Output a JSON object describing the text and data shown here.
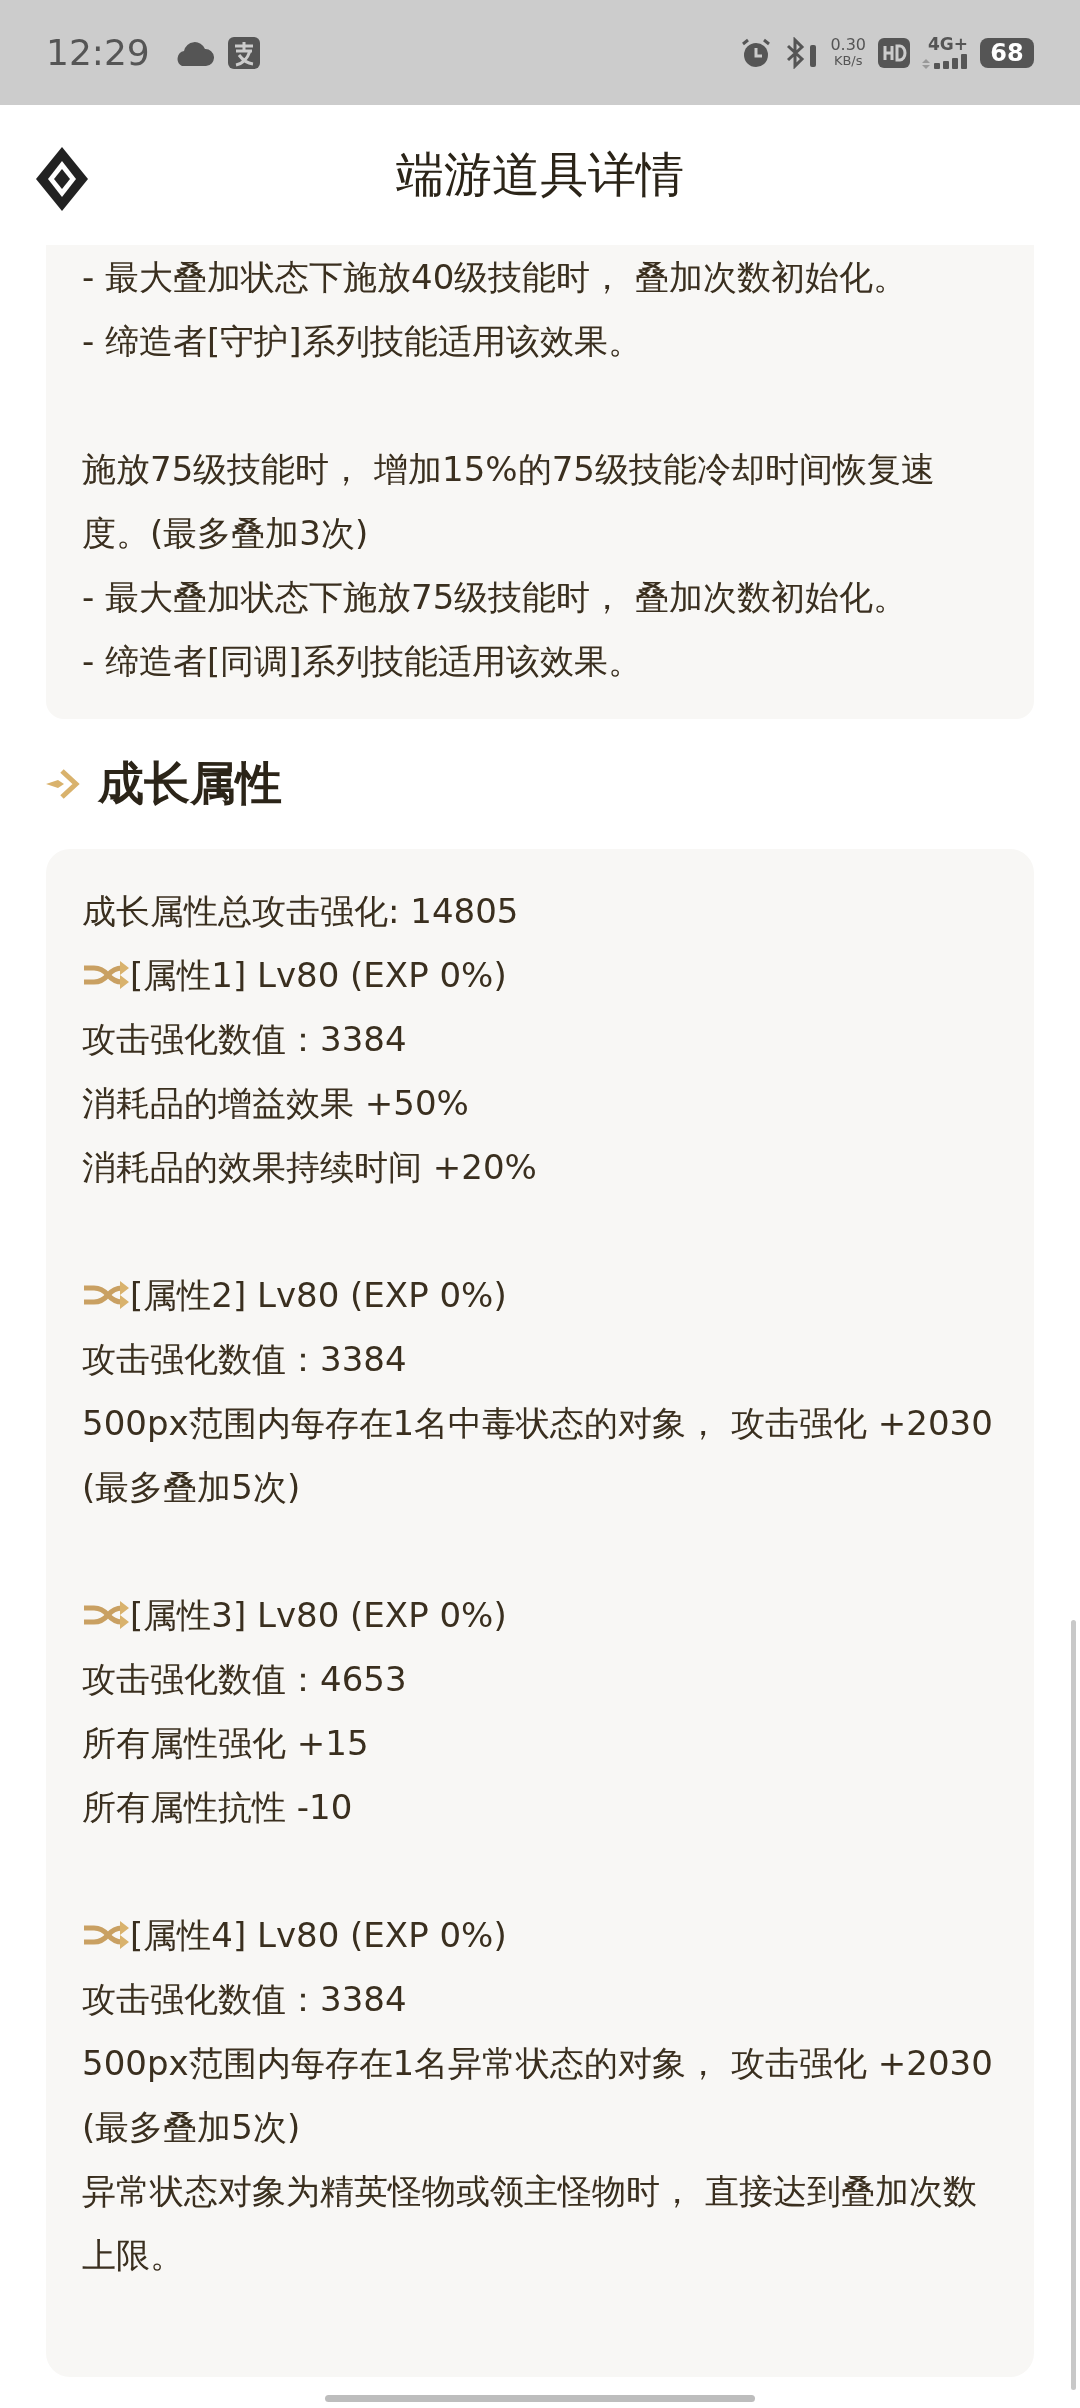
{
  "status_bar": {
    "time": "12:29",
    "net_speed": "0.30",
    "net_unit": "KB/s",
    "network": "4G+",
    "battery": "68"
  },
  "header": {
    "title": "端游道具详情"
  },
  "effect_card": {
    "paragraphs": [
      {
        "lines": [
          "- 最大叠加状态下施放40级技能时， 叠加次数初始化。",
          "- 缔造者[守护]系列技能适用该效果。"
        ]
      },
      {
        "lines": [
          "施放75级技能时， 增加15%的75级技能冷却时间恢复速度。(最多叠加3次)",
          "- 最大叠加状态下施放75级技能时， 叠加次数初始化。",
          "- 缔造者[同调]系列技能适用该效果。"
        ]
      }
    ]
  },
  "growth_section": {
    "title": "成长属性",
    "total": "成长属性总攻击强化: 14805",
    "attributes": [
      {
        "header": "[属性1] Lv80 (EXP 0%)",
        "lines": [
          "攻击强化数值：3384",
          "消耗品的增益效果 +50%",
          "消耗品的效果持续时间 +20%"
        ]
      },
      {
        "header": "[属性2] Lv80 (EXP 0%)",
        "lines": [
          "攻击强化数值：3384",
          "500px范围内每存在1名中毒状态的对象， 攻击强化 +2030 (最多叠加5次)"
        ]
      },
      {
        "header": "[属性3] Lv80 (EXP 0%)",
        "lines": [
          "攻击强化数值：4653",
          "所有属性强化 +15",
          "所有属性抗性 -10"
        ]
      },
      {
        "header": "[属性4] Lv80 (EXP 0%)",
        "lines": [
          "攻击强化数值：3384",
          "500px范围内每存在1名异常状态的对象， 攻击强化 +2030 (最多叠加5次)",
          "异常状态对象为精英怪物或领主怪物时， 直接达到叠加次数上限。"
        ]
      }
    ]
  }
}
